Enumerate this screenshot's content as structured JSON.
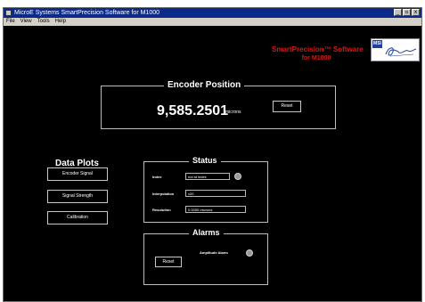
{
  "window": {
    "title": "MicroE Systems SmartPrecision Software for M1000",
    "controls": [
      "_",
      "▫",
      "x"
    ]
  },
  "menu": [
    "File",
    "View",
    "Tools",
    "Help"
  ],
  "brand": {
    "line1": "SmartPrecision™ Software",
    "line2": "for M1000",
    "logo_badge": "MSI",
    "color": "#d01818"
  },
  "encoder": {
    "title": "Encoder Position",
    "value": "9,585.2501",
    "unit": "microns",
    "reset_label": "Reset"
  },
  "data_plots": {
    "title": "Data Plots",
    "buttons": [
      "Encoder Signal",
      "Signal Strength",
      "Calibration"
    ]
  },
  "status": {
    "title": "Status",
    "index_label": "Index",
    "index_value": "not at index",
    "interpolation_label": "Interpolation",
    "interpolation_value": "x20",
    "resolution_label": "Resolution",
    "resolution_value": "0.0050 microns"
  },
  "alarms": {
    "title": "Alarms",
    "reset_label": "Reset",
    "amplitude_label": "Amplitude Alarm"
  }
}
